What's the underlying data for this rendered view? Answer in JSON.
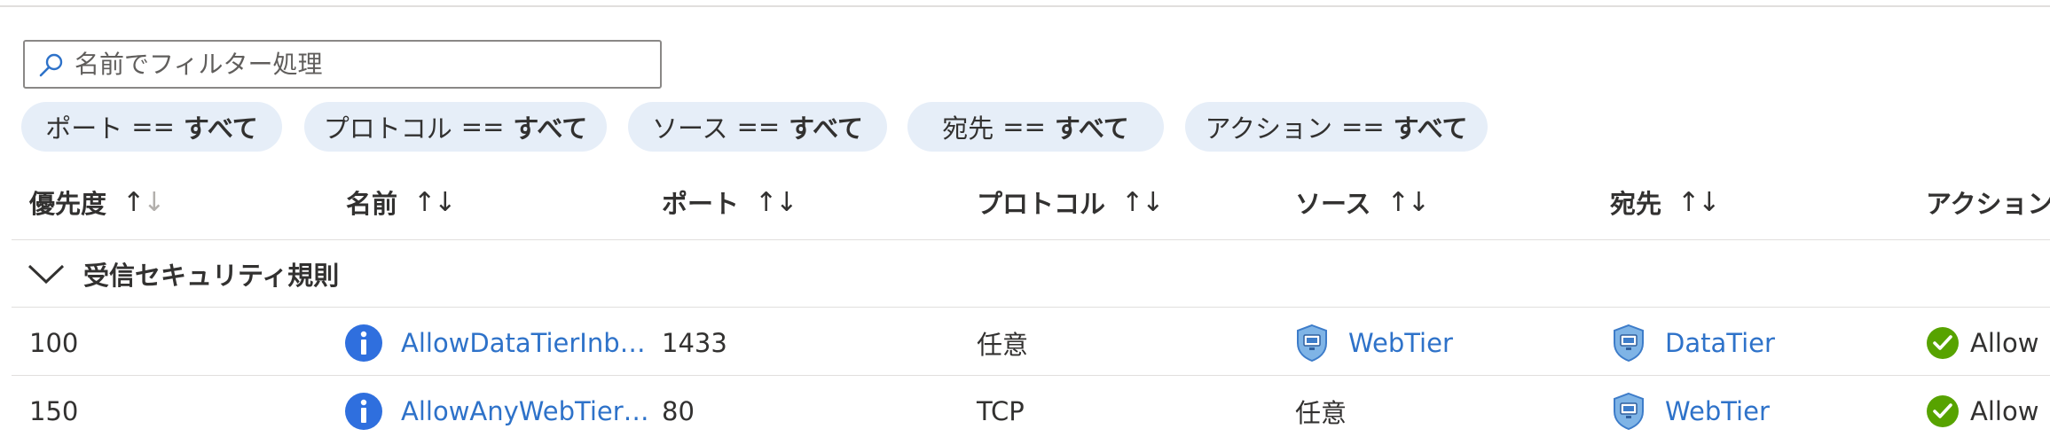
{
  "search": {
    "placeholder": "名前でフィルター処理",
    "icon": "search-icon"
  },
  "filters": [
    {
      "key": "ポート",
      "op": "==",
      "value": "すべて"
    },
    {
      "key": "プロトコル",
      "op": "==",
      "value": "すべて"
    },
    {
      "key": "ソース",
      "op": "==",
      "value": "すべて"
    },
    {
      "key": "宛先",
      "op": "==",
      "value": "すべて"
    },
    {
      "key": "アクション",
      "op": "==",
      "value": "すべて"
    }
  ],
  "columns": [
    "優先度",
    "名前",
    "ポート",
    "プロトコル",
    "ソース",
    "宛先",
    "アクション"
  ],
  "sort_glyphs": {
    "up": "↑",
    "down": "↓"
  },
  "group": {
    "label": "受信セキュリティ規則",
    "icon": "chevron-down-icon"
  },
  "rows": [
    {
      "priority": "100",
      "name": "AllowDataTierInb…",
      "port": "1433",
      "protocol": "任意",
      "source": "WebTier",
      "destination": "DataTier",
      "action": "Allow"
    },
    {
      "priority": "150",
      "name": "AllowAnyWebTier…",
      "port": "80",
      "protocol": "TCP",
      "source": "任意",
      "destination": "WebTier",
      "action": "Allow"
    }
  ],
  "colors": {
    "link": "#2e72c9",
    "info": "#2f6fde",
    "allow": "#57a300",
    "pill": "#e6eef8",
    "divider": "#e1dfdd"
  }
}
